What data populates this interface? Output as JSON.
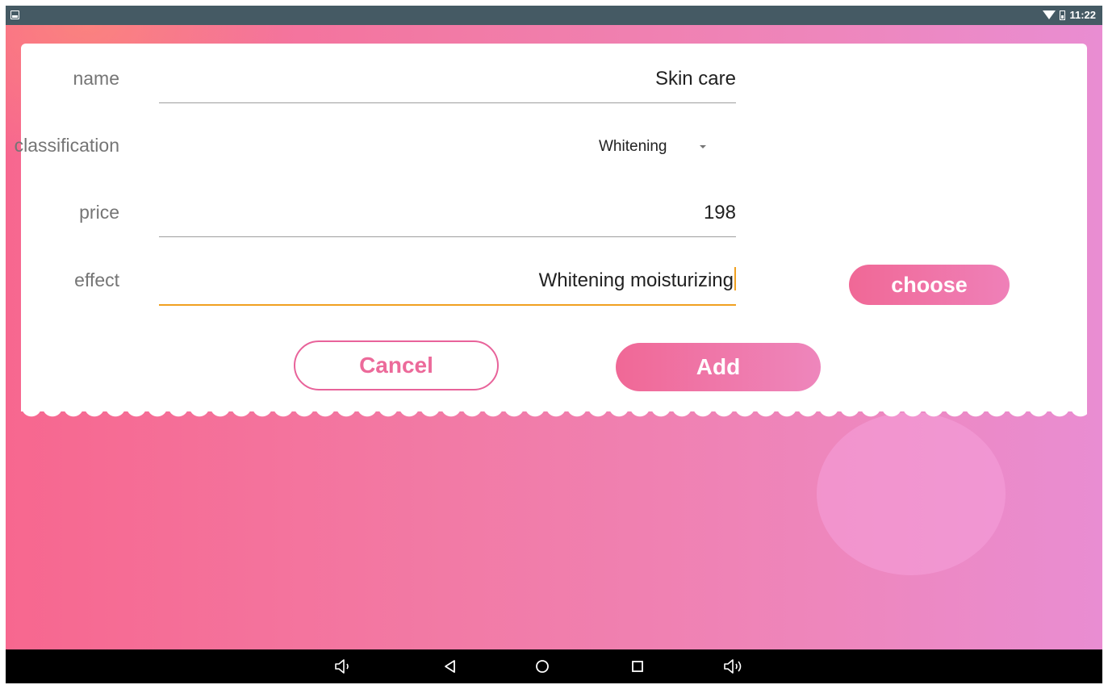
{
  "status_bar": {
    "time": "11:22",
    "left_icon": "image-notification-icon",
    "wifi_icon": "wifi-icon",
    "battery_icon": "battery-icon"
  },
  "form": {
    "name": {
      "label": "name",
      "value": "Skin care"
    },
    "classification": {
      "label": "classification",
      "selected": "Whitening"
    },
    "price": {
      "label": "price",
      "value": "198"
    },
    "effect": {
      "label": "effect",
      "value": "Whitening moisturizing"
    }
  },
  "buttons": {
    "choose": "choose",
    "cancel": "Cancel",
    "add": "Add"
  },
  "colors": {
    "accent_pink": "#f06896",
    "focus_orange": "#f0a020",
    "status_bar": "#455a64"
  },
  "nav_bar": {
    "icons": [
      "volume-down-icon",
      "back-icon",
      "home-icon",
      "recents-icon",
      "volume-up-icon"
    ]
  }
}
